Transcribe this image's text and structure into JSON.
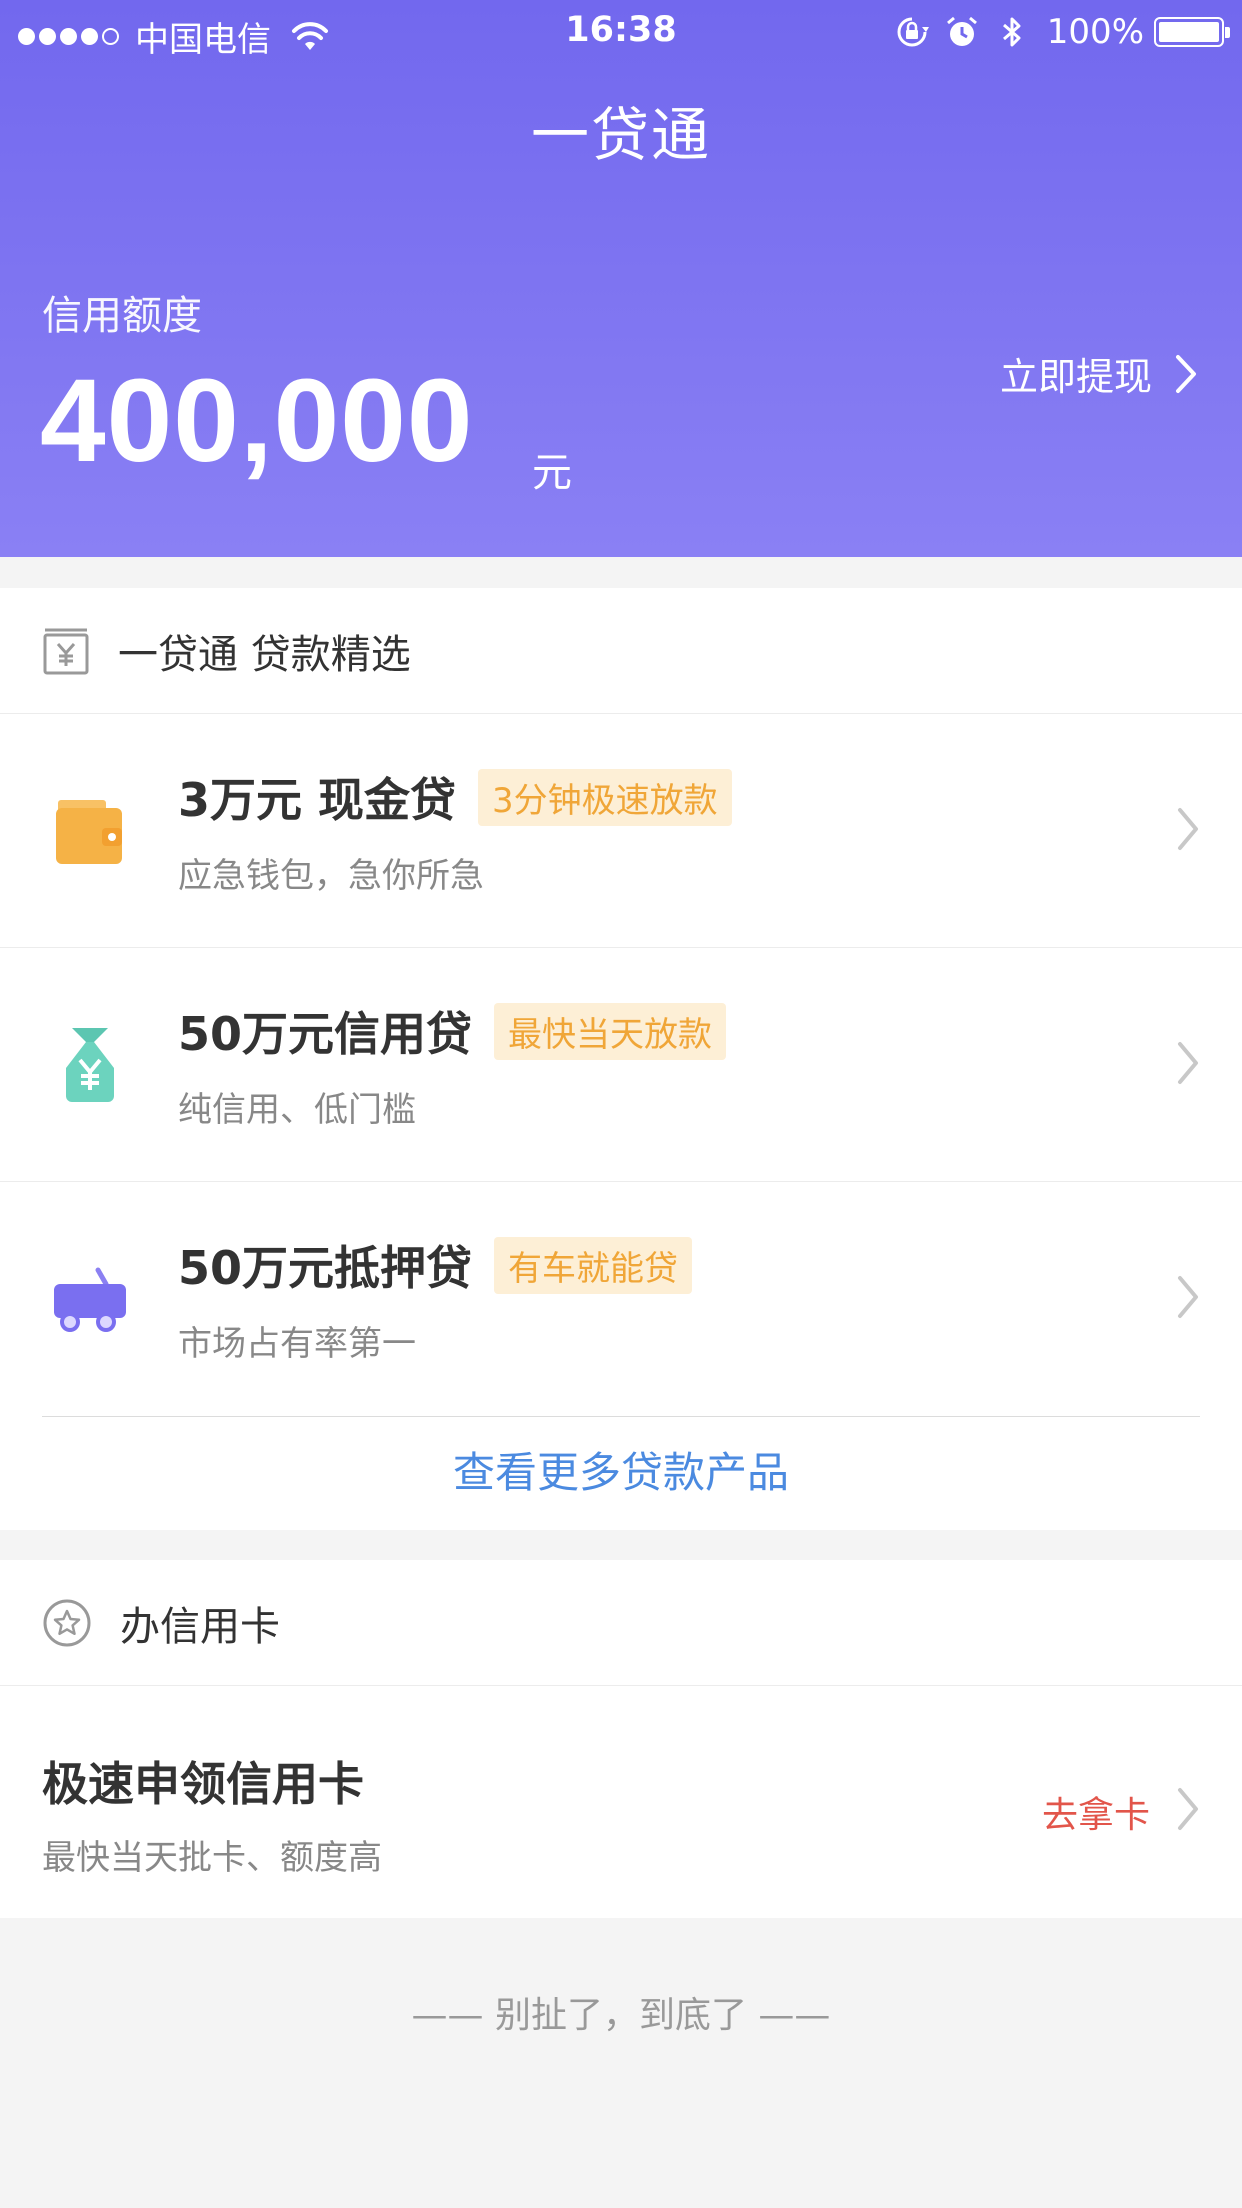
{
  "status_bar": {
    "carrier": "中国电信",
    "time": "16:38",
    "battery": "100%"
  },
  "header": {
    "title": "一贷通",
    "credit_label": "信用额度",
    "credit_amount": "400,000",
    "credit_unit": "元",
    "withdraw_label": "立即提现"
  },
  "loans": {
    "section_title": "一贷通 贷款精选",
    "items": [
      {
        "title": "3万元 现金贷",
        "tag": "3分钟极速放款",
        "subtitle": "应急钱包，急你所急",
        "icon": "wallet-icon"
      },
      {
        "title": "50万元信用贷",
        "tag": "最快当天放款",
        "subtitle": "纯信用、低门槛",
        "icon": "money-bag-icon"
      },
      {
        "title": "50万元抵押贷",
        "tag": "有车就能贷",
        "subtitle": "市场占有率第一",
        "icon": "car-icon"
      }
    ],
    "more_label": "查看更多贷款产品"
  },
  "credit_card": {
    "section_title": "办信用卡",
    "title": "极速申领信用卡",
    "subtitle": "最快当天批卡、额度高",
    "action_label": "去拿卡"
  },
  "footer": {
    "note": "—— 别扯了，到底了 ——"
  },
  "colors": {
    "header_start": "#7268ee",
    "header_end": "#8a80f4",
    "tag_bg": "#fdefd6",
    "tag_text": "#f0a638",
    "link": "#4b8ae0",
    "action": "#e2554a"
  }
}
